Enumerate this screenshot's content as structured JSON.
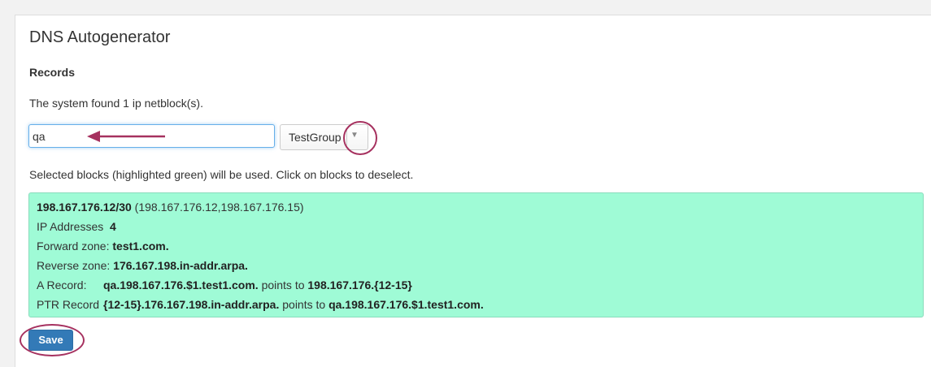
{
  "title": "DNS Autogenerator",
  "section_heading": "Records",
  "found_text": "The system found 1 ip netblock(s).",
  "filter_input": {
    "value": "qa"
  },
  "group_select": {
    "selected": "TestGroup",
    "arrow": "▼"
  },
  "instructions": "Selected blocks (highlighted green) will be used. Click on blocks to deselect.",
  "block": {
    "cidr": "198.167.176.12/30",
    "range": " (198.167.176.12,198.167.176.15)",
    "ip_addresses_label": "IP Addresses",
    "ip_addresses_value": "4",
    "forward_zone_label": "Forward zone:",
    "forward_zone_value": "test1.com.",
    "reverse_zone_label": "Reverse zone:",
    "reverse_zone_value": "176.167.198.in-addr.arpa.",
    "a_record_label": "A Record:",
    "a_record_name": "qa.198.167.176.$1.test1.com.",
    "points_to": " points to ",
    "a_record_target": "198.167.176.{12-15}",
    "ptr_record_label": "PTR Record",
    "ptr_record_name": "{12-15}.176.167.198.in-addr.arpa.",
    "ptr_record_target": "qa.198.167.176.$1.test1.com."
  },
  "save_label": "Save",
  "colors": {
    "block_bg": "#9ffbd6",
    "primary_button": "#337ab7",
    "annotation": "#a6315f",
    "input_focus": "#66afe9"
  }
}
